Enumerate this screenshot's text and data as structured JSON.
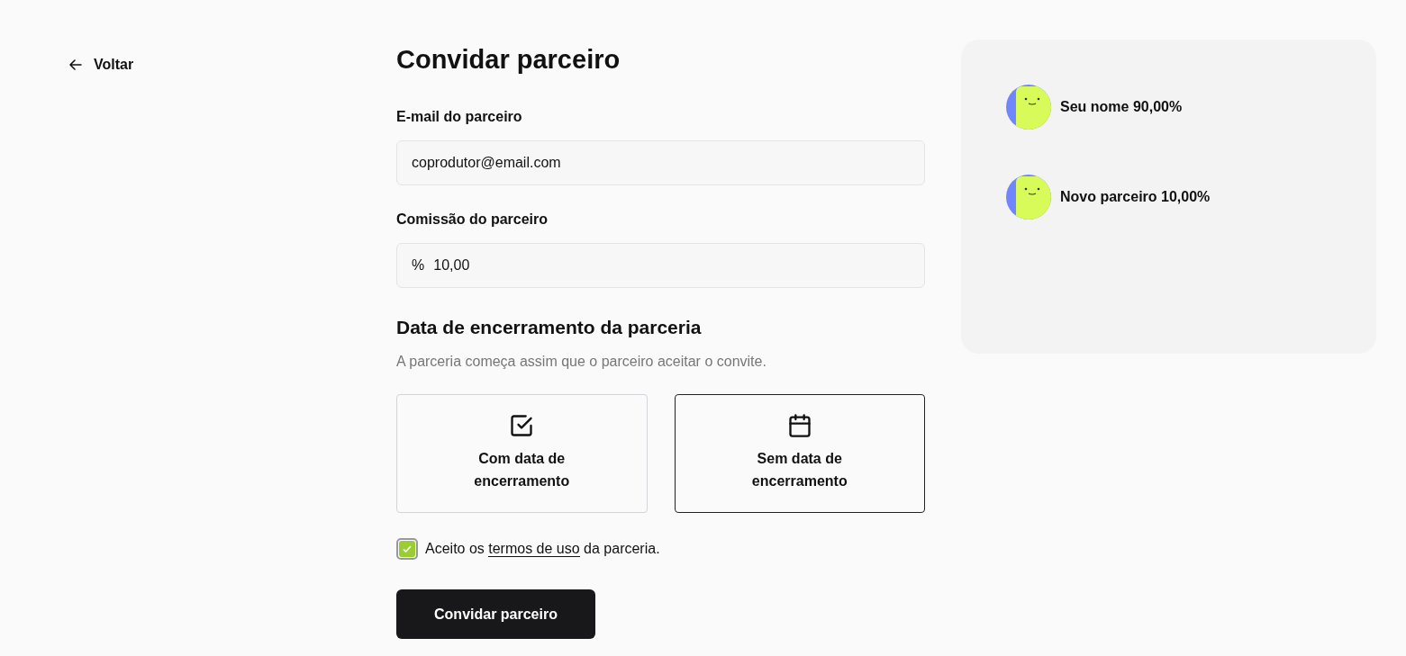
{
  "back_link": "Voltar",
  "title": "Convidar parceiro",
  "fields": [
    {
      "label": "E-mail do parceiro",
      "value": "coprodutor@email.com"
    },
    {
      "label": "Comissão do parceiro",
      "prefix": "%",
      "value": "10,00"
    }
  ],
  "end_date": {
    "heading": "Data de encerramento da parceria",
    "description": "A parceria começa assim que o parceiro aceitar o convite.",
    "options": [
      {
        "kind": "check",
        "label": "Com data de encerramento",
        "selected": false
      },
      {
        "kind": "calendar",
        "label": "Sem data de encerramento",
        "selected": true
      }
    ]
  },
  "terms": {
    "checked": true,
    "before": "Aceito os",
    "link": "termos de uso",
    "after": "da parceria."
  },
  "submit_button": "Convidar parceiro",
  "split": [
    {
      "label": "Seu nome 90,00%"
    },
    {
      "label": "Novo parceiro 10,00%"
    }
  ]
}
